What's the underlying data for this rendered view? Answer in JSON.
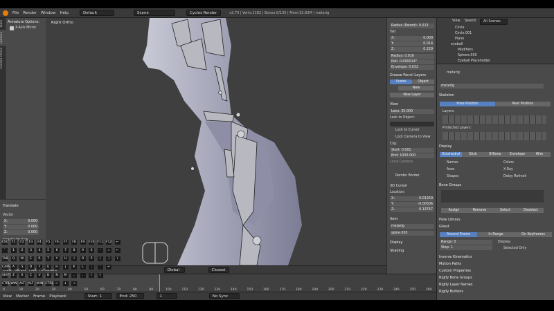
{
  "info_header": {
    "menus": [
      "File",
      "Render",
      "Window",
      "Help"
    ],
    "layout": "Default",
    "scene": "Scene",
    "engine": "Cycles Render",
    "stats": "v2.79 | Verts:1182 | Bones:0/135 | Mem:52.62M | metarig"
  },
  "toolshelf": {
    "tabs": [
      "Tools",
      "Options",
      "Grease Pencil"
    ],
    "armature_options": "Armature Options:",
    "x_axis_mirror": "X-Axis Mirror"
  },
  "operator": {
    "title": "Translate",
    "vector_label": "Vector",
    "x": "0.000",
    "y": "0.000",
    "z": "0.000",
    "constraint_axis": "Constraint Axis"
  },
  "viewport": {
    "view_name": "Right Ortho",
    "header": [
      "View",
      "Select",
      "Add",
      "Armature"
    ],
    "pivot": "Global",
    "snap": "Closest"
  },
  "n_panel": {
    "radius_parent": "Radius (Parent): 0.013",
    "tail": "Tail:",
    "tail_x": "0.000",
    "tail_y": "0.014",
    "tail_z": "0.229",
    "radius": "Radius: 0.016",
    "roll": "Roll: 0.000014°",
    "envelope": "Envelope: 0.032",
    "grease_pencil": "Grease Pencil Layers",
    "scene_btn": "Scene",
    "object_btn": "Object",
    "new_btn": "New",
    "new_layer_btn": "New Layer",
    "view_section": "View",
    "lens": "Lens: 35.000",
    "lock_to_object": "Lock to Object:",
    "lock_to_cursor": "Lock to Cursor",
    "lock_camera": "Lock Camera to View",
    "clip": "Clip:",
    "clip_start": "Start: 0.001",
    "clip_end": "End: 1000.000",
    "local_camera": "Local Camera:",
    "render_border": "Render Border",
    "cursor_section": "3D Cursor",
    "location": "Location:",
    "cursor_x": "0.01259",
    "cursor_y": "-0.00506",
    "cursor_z": "0.13767",
    "item_section": "Item",
    "item_name": "metarig",
    "bone_name": "spine.005",
    "display_section": "Display",
    "shading_section": "Shading"
  },
  "outliner": {
    "view": "View",
    "search": "Search",
    "scenes": "All Scenes",
    "items": [
      "Circle",
      "Circle.001",
      "Plane",
      "eyeball",
      "Modifiers",
      "Sphere.000",
      "Eyeball Placeholder"
    ]
  },
  "properties": {
    "object_name": "metarig",
    "data_name": "metarig",
    "skeleton": "Skeleton",
    "pose_position": "Pose Position",
    "rest_position": "Rest Position",
    "layers": "Layers:",
    "protected_layers": "Protected Layers:",
    "display": "Display",
    "display_types": [
      "Octahedral",
      "Stick",
      "B-Bone",
      "Envelope",
      "Wire"
    ],
    "names": "Names",
    "colors": "Colors",
    "axes": "Axes",
    "xray": "X-Ray",
    "shapes": "Shapes",
    "delay_refresh": "Delay Refresh",
    "bone_groups": "Bone Groups",
    "bg_buttons": [
      "Assign",
      "Remove",
      "Select",
      "Deselect"
    ],
    "pose_library": "Pose Library",
    "ghost": "Ghost",
    "ghost_types": [
      "Around Frame",
      "In Range",
      "On Keyframes"
    ],
    "range": "Range: 0",
    "step": "Step: 1",
    "ghost_display": "Display:",
    "selected_only": "Selected Only",
    "more_sections": [
      "Inverse Kinematics",
      "Motion Paths",
      "Custom Properties",
      "Rigify Bone Groups",
      "Rigify Layer Names",
      "Rigify Buttons"
    ]
  },
  "timeline": {
    "ticks": [
      "0",
      "10",
      "20",
      "30",
      "40",
      "50",
      "60",
      "70",
      "80",
      "90",
      "100",
      "110",
      "120",
      "130",
      "140",
      "150",
      "160",
      "170",
      "180",
      "190",
      "200",
      "210",
      "220",
      "230",
      "240",
      "250",
      "260"
    ],
    "menus": [
      "View",
      "Marker",
      "Frame",
      "Playback"
    ],
    "start": "Start: 1",
    "end": "End: 250",
    "current": "1",
    "sync": "No Sync"
  },
  "keyboard": {
    "row1": [
      "ESC",
      "F1",
      "F2",
      "F3",
      "F4",
      "F5",
      "F6",
      "F7",
      "F8",
      "F9",
      "F10",
      "F11",
      "F12",
      "←"
    ],
    "row2": [
      "`",
      "1",
      "2",
      "3",
      "4",
      "5",
      "6",
      "7",
      "8",
      "9",
      "0",
      "-",
      "=",
      "←"
    ],
    "row3": [
      "TAB",
      "Q",
      "W",
      "E",
      "R",
      "T",
      "Y",
      "U",
      "I",
      "O",
      "P",
      "[",
      "]",
      "\\"
    ],
    "row4": [
      "CAPS",
      "A",
      "S",
      "D",
      "F",
      "G",
      "H",
      "J",
      "K",
      "L",
      ";",
      "'",
      "↵"
    ],
    "row5": [
      "SHIFT",
      "Z",
      "X",
      "C",
      "V",
      "B",
      "N",
      "M",
      ",",
      ".",
      "/",
      "↑"
    ],
    "row6": [
      "CTRL",
      "WIN",
      "ALT",
      "ALT",
      "WIN",
      "CTRL",
      "←",
      "↓",
      "→"
    ]
  }
}
